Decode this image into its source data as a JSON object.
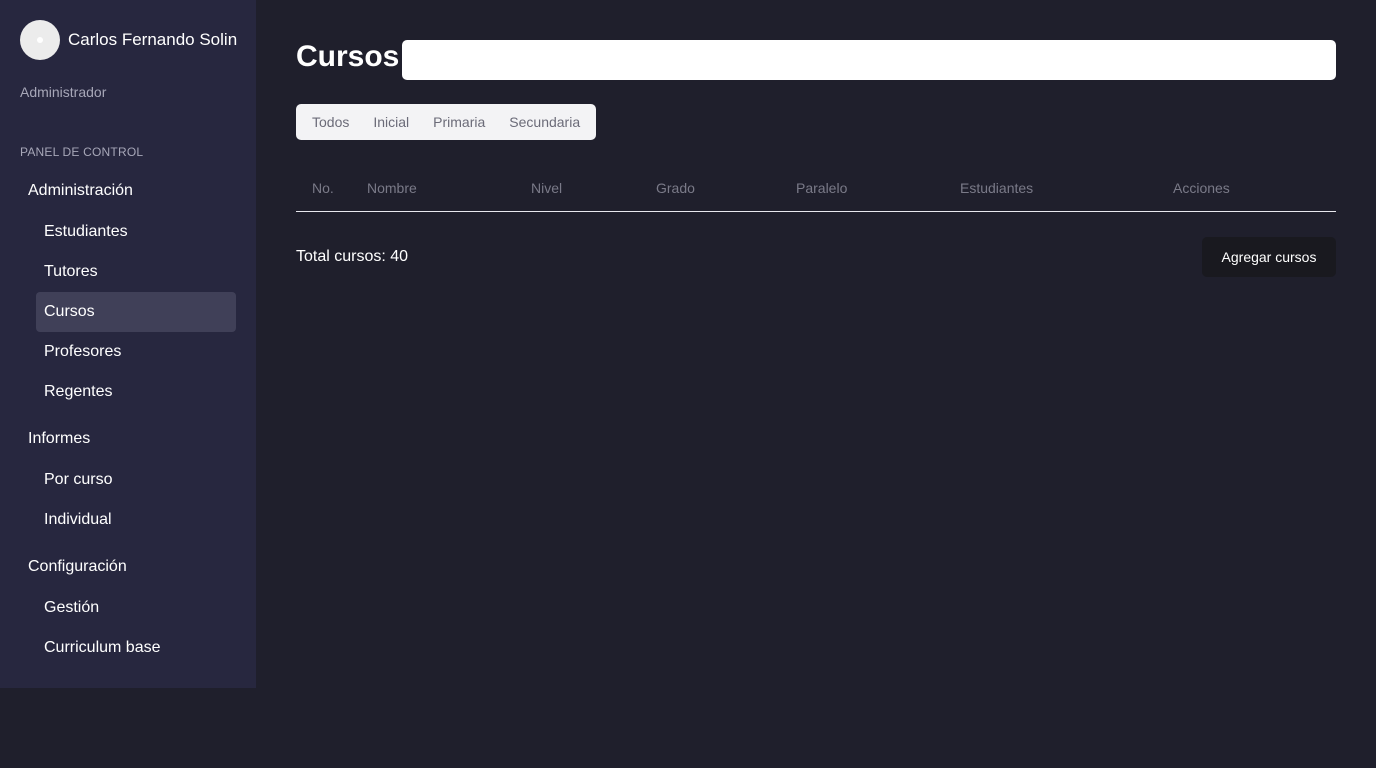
{
  "sidebar": {
    "user_name": "Carlos Fernando Solin",
    "user_role": "Administrador",
    "section_title": "PANEL DE CONTROL",
    "groups": [
      {
        "label": "Administración",
        "items": [
          "Estudiantes",
          "Tutores",
          "Cursos",
          "Profesores",
          "Regentes"
        ]
      },
      {
        "label": "Informes",
        "items": [
          "Por curso",
          "Individual"
        ]
      },
      {
        "label": "Configuración",
        "items": [
          "Gestión",
          "Curriculum base"
        ]
      }
    ],
    "active_item": "Cursos"
  },
  "main": {
    "title": "Cursos",
    "search": {
      "value": "",
      "placeholder": ""
    },
    "tabs": [
      "Todos",
      "Inicial",
      "Primaria",
      "Secundaria"
    ],
    "table": {
      "columns": [
        "No.",
        "Nombre",
        "Nivel",
        "Grado",
        "Paralelo",
        "Estudiantes",
        "Acciones"
      ],
      "rows": []
    },
    "total_label": "Total cursos: 40",
    "add_button_label": "Agregar cursos"
  },
  "colors": {
    "background": "#1f1f2c",
    "sidebar": "#27273f",
    "active_nav": "#404058",
    "button": "#19191f"
  }
}
